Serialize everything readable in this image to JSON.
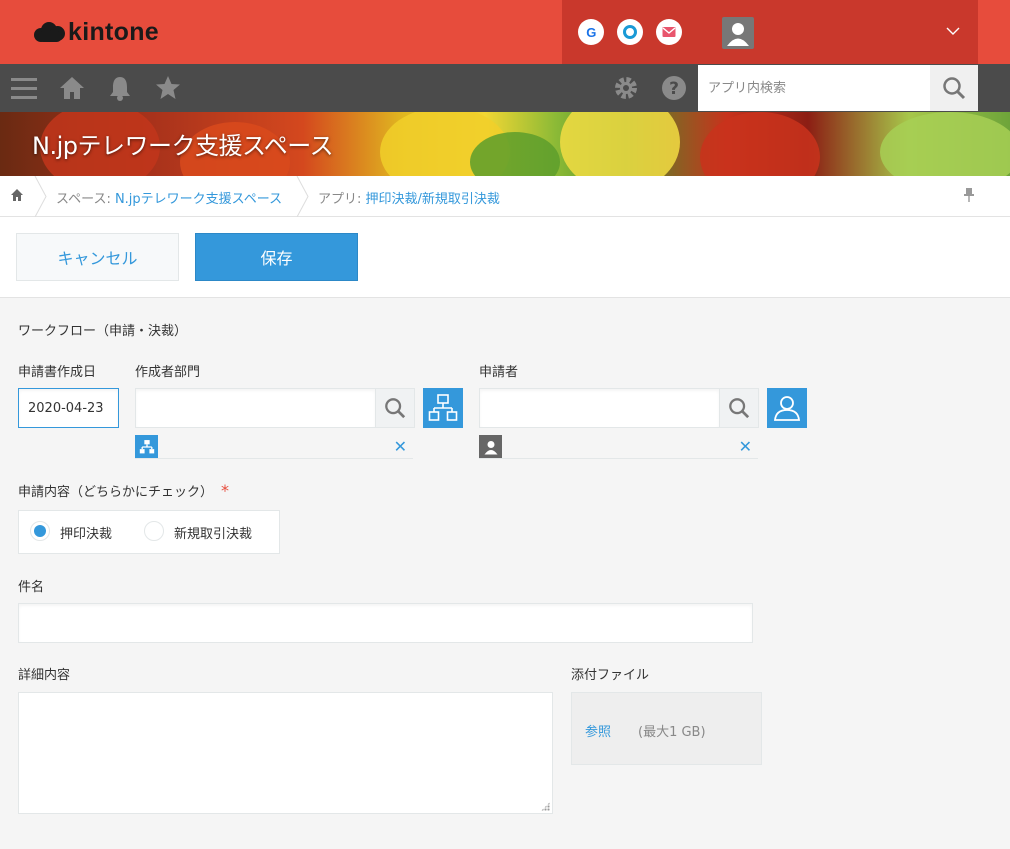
{
  "header": {
    "logo_text": "kintone",
    "apps": [
      {
        "name": "google-app-icon",
        "glyph": "G",
        "color": "#1a73e8"
      },
      {
        "name": "garoon-app-icon",
        "glyph": "○",
        "color": "#1a9ad6"
      },
      {
        "name": "mail-app-icon",
        "glyph": "✉",
        "color": "#e8556d"
      }
    ],
    "brand_color": "#e74c3c"
  },
  "nav": {
    "search_placeholder": "アプリ内検索"
  },
  "banner": {
    "space_title": "N.jpテレワーク支援スペース"
  },
  "breadcrumb": {
    "space_prefix": "スペース: ",
    "space_name": "N.jpテレワーク支援スペース",
    "app_prefix": "アプリ: ",
    "app_name": "押印決裁/新規取引決裁"
  },
  "actions": {
    "cancel_label": "キャンセル",
    "save_label": "保存"
  },
  "form": {
    "group_label": "ワークフロー（申請・決裁）",
    "date_label": "申請書作成日",
    "date_value": "2020-04-23",
    "dept_label": "作成者部門",
    "dept_value": "",
    "applicant_label": "申請者",
    "applicant_value": "",
    "content_label": "申請内容（どちらかにチェック）",
    "required_mark": "*",
    "radio_options": [
      "押印決裁",
      "新規取引決裁"
    ],
    "radio_selected": "押印決裁",
    "subject_label": "件名",
    "subject_value": "",
    "detail_label": "詳細内容",
    "detail_value": "",
    "attach_label": "添付ファイル",
    "attach_browse": "参照",
    "attach_limit": "(最大1 GB)"
  },
  "accent_color": "#3498db"
}
